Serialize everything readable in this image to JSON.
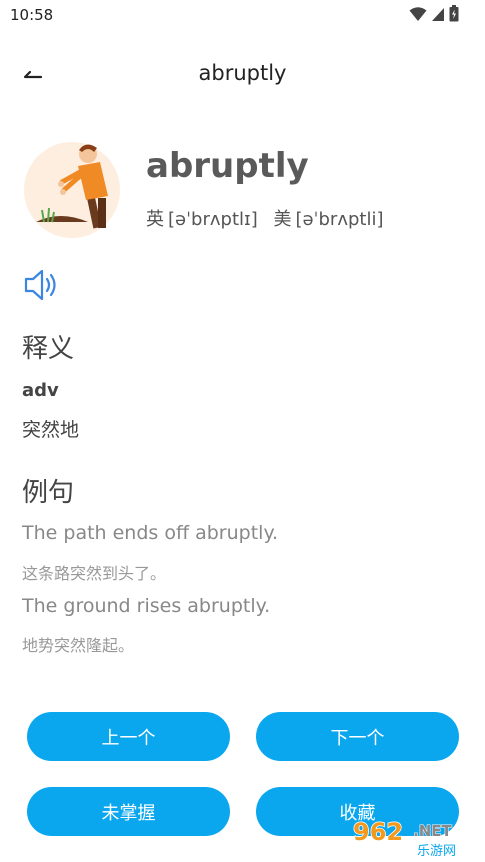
{
  "status_bar": {
    "time": "10:58"
  },
  "app_bar": {
    "title": "abruptly"
  },
  "word": {
    "text": "abruptly",
    "uk_label": "英",
    "uk_phonetic": "[əˈbrʌptlɪ]",
    "us_label": "美",
    "us_phonetic": "[əˈbrʌptli]"
  },
  "definition": {
    "title": "释义",
    "pos": "adv",
    "meaning": "突然地"
  },
  "examples": {
    "title": "例句",
    "items": [
      {
        "en": "The path ends off abruptly.",
        "zh": "这条路突然到头了。"
      },
      {
        "en": "The ground rises abruptly.",
        "zh": "地势突然隆起。"
      }
    ]
  },
  "buttons": {
    "prev": "上一个",
    "next": "下一个",
    "not_mastered": "未掌握",
    "favorite": "收藏"
  },
  "watermark": {
    "logo": "962.NET",
    "sub": "乐游网"
  },
  "colors": {
    "accent": "#0aa7ee",
    "speaker": "#3a86e0"
  }
}
